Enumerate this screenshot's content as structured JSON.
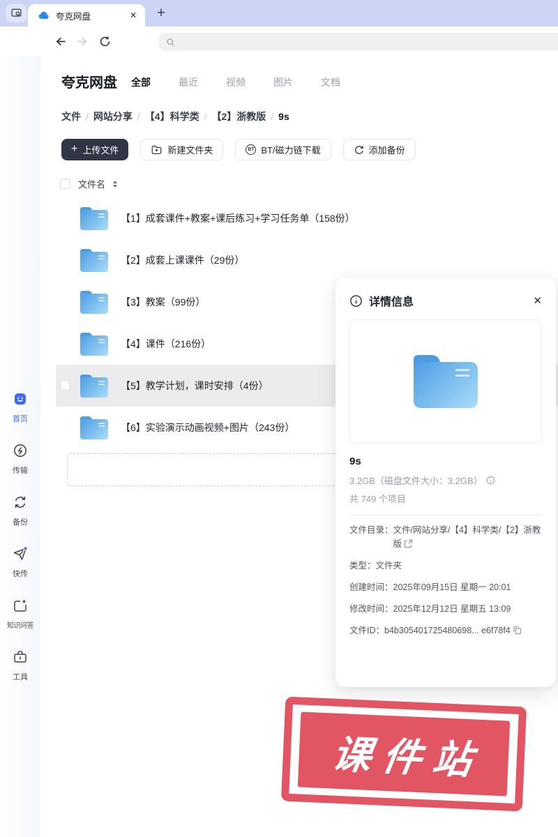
{
  "colors": {
    "accent_blue": "#3E6BF2",
    "stamp_red": "#E25663",
    "folder_blue": "#4F9DE3",
    "tabbar_lavender": "#CDD5F6",
    "upload_button_bg": "#303646",
    "selected_row_bg": "#ECECEE"
  },
  "icons": {
    "close_x": "✕",
    "new_tab_plus": "+",
    "upload_plus": "+",
    "bt_label": "BT"
  },
  "browser": {
    "tab_title": "夸克网盘",
    "search_value": "",
    "search_placeholder": ""
  },
  "sidebar": {
    "items": [
      {
        "label": "首页",
        "active": true
      },
      {
        "label": "传输",
        "active": false
      },
      {
        "label": "备份",
        "active": false
      },
      {
        "label": "快传",
        "active": false
      },
      {
        "label": "知识问答",
        "active": false
      },
      {
        "label": "工具",
        "active": false
      }
    ]
  },
  "header": {
    "brand": "夸克网盘",
    "tabs": [
      {
        "label": "全部",
        "active": true
      },
      {
        "label": "最近",
        "active": false
      },
      {
        "label": "视频",
        "active": false
      },
      {
        "label": "图片",
        "active": false
      },
      {
        "label": "文档",
        "active": false
      }
    ]
  },
  "breadcrumb": {
    "separator": "/",
    "items": [
      "文件",
      "网站分享",
      "【4】科学类",
      "【2】浙教版",
      "9s"
    ]
  },
  "toolbar": {
    "upload_label": "上传文件",
    "new_folder_label": "新建文件夹",
    "bt_label": "BT/磁力链下载",
    "backup_label": "添加备份"
  },
  "list": {
    "header_label": "文件名",
    "rows": [
      {
        "name": "【1】成套课件+教案+课后练习+学习任务单（158份）",
        "selected": false
      },
      {
        "name": "【2】成套上课课件（29份）",
        "selected": false
      },
      {
        "name": "【3】教案（99份）",
        "selected": false
      },
      {
        "name": "【4】课件（216份）",
        "selected": false
      },
      {
        "name": "【5】教学计划，课时安排（4份）",
        "selected": true
      },
      {
        "name": "【6】实验演示动画视频+图片（243份）",
        "selected": false
      }
    ]
  },
  "details": {
    "title": "详情信息",
    "name": "9s",
    "size_line": "3.2GB（磁盘文件大小：3.2GB）",
    "count_line": "共 749 个项目",
    "path_label": "文件目录：",
    "path_value": "文件/网站分享/【4】科学类/【2】浙教版",
    "type_label": "类型：",
    "type_value": "文件夹",
    "created_label": "创建时间：",
    "created_value": "2025年09月15日 星期一 20:01",
    "modified_label": "修改时间：",
    "modified_value": "2025年12月12日 星期五 13:09",
    "file_id_label": "文件ID：",
    "file_id_value": "b4b305401725480698... e6f78f4"
  },
  "stamp": {
    "text": "课件站"
  }
}
